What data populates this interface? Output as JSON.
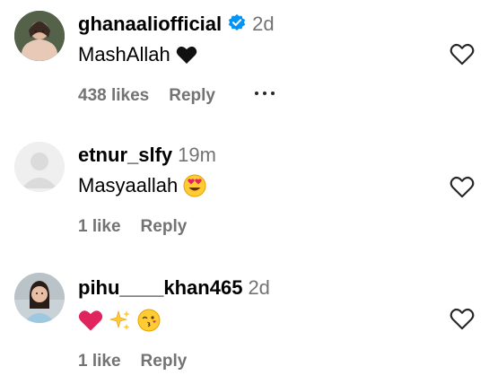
{
  "comments": [
    {
      "username": "ghanaaliofficial",
      "verified": true,
      "time": "2d",
      "text": "MashAllah",
      "emoji": [
        "black-heart"
      ],
      "likes_label": "438 likes",
      "reply_label": "Reply",
      "has_more": true,
      "avatar": "photo"
    },
    {
      "username": "etnur_slfy",
      "verified": false,
      "time": "19m",
      "text": "Masyaallah",
      "emoji": [
        "heart-eyes-face"
      ],
      "likes_label": "1 like",
      "reply_label": "Reply",
      "has_more": false,
      "avatar": "default"
    },
    {
      "username": "pihu____khan465",
      "verified": false,
      "time": "2d",
      "text": "",
      "emoji": [
        "red-heart",
        "sparkles",
        "kissing-wink-face"
      ],
      "likes_label": "1 like",
      "reply_label": "Reply",
      "has_more": false,
      "avatar": "photo"
    }
  ],
  "icons": {
    "like": "heart-outline-icon",
    "verified": "verified-badge-icon",
    "more": "more-options-icon"
  },
  "colors": {
    "verified_blue": "#0095f6",
    "secondary_text": "#737373",
    "red_heart": "#e0245e"
  }
}
